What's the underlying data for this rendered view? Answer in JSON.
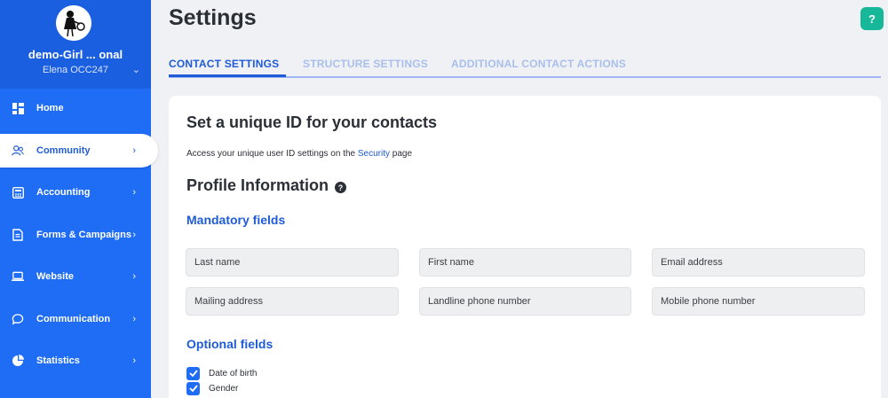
{
  "sidebar": {
    "org_name": "demo-Girl ... onal",
    "user": "Elena OCC247",
    "items": [
      {
        "label": "Home"
      },
      {
        "label": "Community"
      },
      {
        "label": "Accounting"
      },
      {
        "label": "Forms & Campaigns"
      },
      {
        "label": "Website"
      },
      {
        "label": "Communication"
      },
      {
        "label": "Statistics"
      }
    ]
  },
  "header": {
    "title": "Settings",
    "help_label": "?"
  },
  "tabs": [
    {
      "label": "CONTACT SETTINGS"
    },
    {
      "label": "STRUCTURE SETTINGS"
    },
    {
      "label": "ADDITIONAL CONTACT ACTIONS"
    }
  ],
  "main": {
    "unique_id_heading": "Set a unique ID for your contacts",
    "access_text_before": "Access your unique user ID settings on the ",
    "access_link": "Security",
    "access_text_after": " page",
    "profile_heading": "Profile Information",
    "mandatory_heading": "Mandatory fields",
    "mandatory_fields": [
      "Last name",
      "First name",
      "Email address",
      "Mailing address",
      "Landline phone number",
      "Mobile phone number"
    ],
    "optional_heading": "Optional fields",
    "optional_fields": [
      {
        "label": "Date of birth",
        "checked": true
      },
      {
        "label": "Gender",
        "checked": true
      }
    ]
  },
  "colors": {
    "sidebar": "#1f6cf5",
    "accent": "#1f5bd6",
    "help_button": "#17b89a"
  },
  "icons": {
    "home": "dashboard-icon",
    "community": "users-icon",
    "accounting": "calculator-icon",
    "forms": "document-icon",
    "website": "laptop-icon",
    "communication": "chat-icon",
    "statistics": "chart-icon"
  }
}
